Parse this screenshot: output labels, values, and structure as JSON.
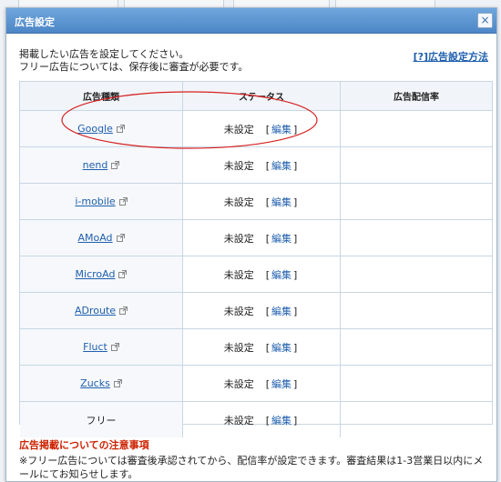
{
  "dialog": {
    "title": "広告設定",
    "close_glyph": "×",
    "intro_line1": "掲載したい広告を設定してください。",
    "intro_line2": "フリー広告については、保存後に審査が必要です。",
    "help_link": "[?]広告設定方法"
  },
  "table": {
    "headers": [
      "広告種類",
      "ステータス",
      "広告配信率"
    ],
    "rows": [
      {
        "name": "Google",
        "status": "未設定",
        "edit": "編集",
        "linked": true
      },
      {
        "name": "nend",
        "status": "未設定",
        "edit": "編集",
        "linked": true
      },
      {
        "name": "i-mobile",
        "status": "未設定",
        "edit": "編集",
        "linked": true
      },
      {
        "name": "AMoAd",
        "status": "未設定",
        "edit": "編集",
        "linked": true
      },
      {
        "name": "MicroAd",
        "status": "未設定",
        "edit": "編集",
        "linked": true
      },
      {
        "name": "ADroute",
        "status": "未設定",
        "edit": "編集",
        "linked": true
      },
      {
        "name": "Fluct",
        "status": "未設定",
        "edit": "編集",
        "linked": true
      },
      {
        "name": "Zucks",
        "status": "未設定",
        "edit": "編集",
        "linked": true
      },
      {
        "name": "フリー",
        "status": "未設定",
        "edit": "編集",
        "linked": false
      }
    ]
  },
  "notice": {
    "title": "広告掲載についての注意事項",
    "body": "※フリー広告については審査後承認されてから、配信率が設定できます。審査結果は1-3営業日以内にメールにてお知らせします。"
  },
  "icons": {
    "external_link": "external-link-icon",
    "annotation": "red-ellipse-highlight"
  },
  "colors": {
    "link": "#1f5fae",
    "title_bar": "#5a92cf",
    "notice_title": "#cc2200",
    "annotation": "#d62020"
  }
}
